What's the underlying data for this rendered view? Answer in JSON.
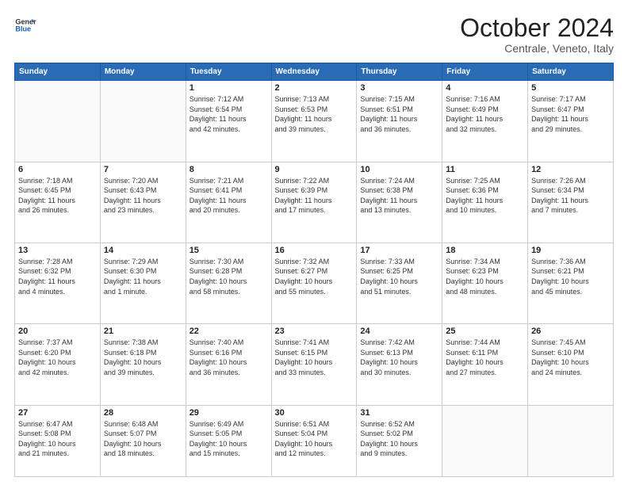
{
  "logo": {
    "line1": "General",
    "line2": "Blue"
  },
  "header": {
    "month": "October 2024",
    "location": "Centrale, Veneto, Italy"
  },
  "weekdays": [
    "Sunday",
    "Monday",
    "Tuesday",
    "Wednesday",
    "Thursday",
    "Friday",
    "Saturday"
  ],
  "weeks": [
    [
      {
        "day": "",
        "info": ""
      },
      {
        "day": "",
        "info": ""
      },
      {
        "day": "1",
        "info": "Sunrise: 7:12 AM\nSunset: 6:54 PM\nDaylight: 11 hours\nand 42 minutes."
      },
      {
        "day": "2",
        "info": "Sunrise: 7:13 AM\nSunset: 6:53 PM\nDaylight: 11 hours\nand 39 minutes."
      },
      {
        "day": "3",
        "info": "Sunrise: 7:15 AM\nSunset: 6:51 PM\nDaylight: 11 hours\nand 36 minutes."
      },
      {
        "day": "4",
        "info": "Sunrise: 7:16 AM\nSunset: 6:49 PM\nDaylight: 11 hours\nand 32 minutes."
      },
      {
        "day": "5",
        "info": "Sunrise: 7:17 AM\nSunset: 6:47 PM\nDaylight: 11 hours\nand 29 minutes."
      }
    ],
    [
      {
        "day": "6",
        "info": "Sunrise: 7:18 AM\nSunset: 6:45 PM\nDaylight: 11 hours\nand 26 minutes."
      },
      {
        "day": "7",
        "info": "Sunrise: 7:20 AM\nSunset: 6:43 PM\nDaylight: 11 hours\nand 23 minutes."
      },
      {
        "day": "8",
        "info": "Sunrise: 7:21 AM\nSunset: 6:41 PM\nDaylight: 11 hours\nand 20 minutes."
      },
      {
        "day": "9",
        "info": "Sunrise: 7:22 AM\nSunset: 6:39 PM\nDaylight: 11 hours\nand 17 minutes."
      },
      {
        "day": "10",
        "info": "Sunrise: 7:24 AM\nSunset: 6:38 PM\nDaylight: 11 hours\nand 13 minutes."
      },
      {
        "day": "11",
        "info": "Sunrise: 7:25 AM\nSunset: 6:36 PM\nDaylight: 11 hours\nand 10 minutes."
      },
      {
        "day": "12",
        "info": "Sunrise: 7:26 AM\nSunset: 6:34 PM\nDaylight: 11 hours\nand 7 minutes."
      }
    ],
    [
      {
        "day": "13",
        "info": "Sunrise: 7:28 AM\nSunset: 6:32 PM\nDaylight: 11 hours\nand 4 minutes."
      },
      {
        "day": "14",
        "info": "Sunrise: 7:29 AM\nSunset: 6:30 PM\nDaylight: 11 hours\nand 1 minute."
      },
      {
        "day": "15",
        "info": "Sunrise: 7:30 AM\nSunset: 6:28 PM\nDaylight: 10 hours\nand 58 minutes."
      },
      {
        "day": "16",
        "info": "Sunrise: 7:32 AM\nSunset: 6:27 PM\nDaylight: 10 hours\nand 55 minutes."
      },
      {
        "day": "17",
        "info": "Sunrise: 7:33 AM\nSunset: 6:25 PM\nDaylight: 10 hours\nand 51 minutes."
      },
      {
        "day": "18",
        "info": "Sunrise: 7:34 AM\nSunset: 6:23 PM\nDaylight: 10 hours\nand 48 minutes."
      },
      {
        "day": "19",
        "info": "Sunrise: 7:36 AM\nSunset: 6:21 PM\nDaylight: 10 hours\nand 45 minutes."
      }
    ],
    [
      {
        "day": "20",
        "info": "Sunrise: 7:37 AM\nSunset: 6:20 PM\nDaylight: 10 hours\nand 42 minutes."
      },
      {
        "day": "21",
        "info": "Sunrise: 7:38 AM\nSunset: 6:18 PM\nDaylight: 10 hours\nand 39 minutes."
      },
      {
        "day": "22",
        "info": "Sunrise: 7:40 AM\nSunset: 6:16 PM\nDaylight: 10 hours\nand 36 minutes."
      },
      {
        "day": "23",
        "info": "Sunrise: 7:41 AM\nSunset: 6:15 PM\nDaylight: 10 hours\nand 33 minutes."
      },
      {
        "day": "24",
        "info": "Sunrise: 7:42 AM\nSunset: 6:13 PM\nDaylight: 10 hours\nand 30 minutes."
      },
      {
        "day": "25",
        "info": "Sunrise: 7:44 AM\nSunset: 6:11 PM\nDaylight: 10 hours\nand 27 minutes."
      },
      {
        "day": "26",
        "info": "Sunrise: 7:45 AM\nSunset: 6:10 PM\nDaylight: 10 hours\nand 24 minutes."
      }
    ],
    [
      {
        "day": "27",
        "info": "Sunrise: 6:47 AM\nSunset: 5:08 PM\nDaylight: 10 hours\nand 21 minutes."
      },
      {
        "day": "28",
        "info": "Sunrise: 6:48 AM\nSunset: 5:07 PM\nDaylight: 10 hours\nand 18 minutes."
      },
      {
        "day": "29",
        "info": "Sunrise: 6:49 AM\nSunset: 5:05 PM\nDaylight: 10 hours\nand 15 minutes."
      },
      {
        "day": "30",
        "info": "Sunrise: 6:51 AM\nSunset: 5:04 PM\nDaylight: 10 hours\nand 12 minutes."
      },
      {
        "day": "31",
        "info": "Sunrise: 6:52 AM\nSunset: 5:02 PM\nDaylight: 10 hours\nand 9 minutes."
      },
      {
        "day": "",
        "info": ""
      },
      {
        "day": "",
        "info": ""
      }
    ]
  ]
}
